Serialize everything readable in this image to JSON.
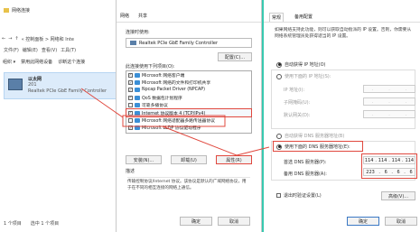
{
  "network_window": {
    "title": "网络连接",
    "address_path": "« 控制面板 > 网络和 Inte",
    "toolbar": [
      "文件(F)",
      "编辑(E)",
      "查看(V)",
      "工具(T)"
    ],
    "commands": [
      "组织 ▾",
      "禁用此网络设备",
      "诊断这个连接"
    ],
    "adapter_name": "以太网",
    "adapter_sub": "201",
    "adapter_desc": "Realtek PCIe GbE Family Controller",
    "status_count": "1 个项目",
    "status_sel": "选中 1 个项目"
  },
  "properties_window": {
    "tabs": [
      "网络",
      "共享"
    ],
    "connect_using_label": "连接时使用:",
    "adapter": "Realtek PCIe GbE Family Controller",
    "configure_button": "配置(C)...",
    "items_label": "此连接使用下列项目(O):",
    "items": [
      {
        "label": "Microsoft 网络客户端",
        "checked": true,
        "highlight": false
      },
      {
        "label": "Microsoft 网络的文件和打印机共享",
        "checked": true,
        "highlight": false
      },
      {
        "label": "Npcap Packet Driver (NPCAP)",
        "checked": true,
        "highlight": false
      },
      {
        "label": "QoS 数据包计划程序",
        "checked": true,
        "highlight": false
      },
      {
        "label": "可靠多播协议",
        "checked": false,
        "highlight": false
      },
      {
        "label": "Internet 协议版本 4 (TCP/IPv4)",
        "checked": true,
        "highlight": true
      },
      {
        "label": "Microsoft 网络适配器多路传送器协议",
        "checked": false,
        "highlight": false
      },
      {
        "label": "Microsoft LLDP 协议驱动程序",
        "checked": true,
        "highlight": false
      }
    ],
    "install_button": "安装(N)...",
    "uninstall_button": "卸载(U)",
    "props_button": "属性(R)",
    "description_label": "描述",
    "description": "传输控制协议/Internet 协议。该协议是默认的广域网络协议，用于在不同的相互连接的网络上通信。",
    "ok_button": "确定",
    "cancel_button": "取消"
  },
  "ipv4_window": {
    "tabs": [
      "常规",
      "备用配置"
    ],
    "description": "如果网络支持此功能，则可以获取自动指派的 IP 设置。否则，你需要从网络系统管理员处获得适当的 IP 设置。",
    "auto_ip": "自动获得 IP 地址(O)",
    "manual_ip": "使用下面的 IP 地址(S):",
    "ip_label": "IP 地址(I):",
    "mask_label": "子网掩码(U):",
    "gateway_label": "默认网关(D):",
    "auto_dns": "自动获得 DNS 服务器地址(B)",
    "manual_dns": "使用下面的 DNS 服务器地址(E):",
    "dns1_label": "首选 DNS 服务器(P):",
    "dns1": [
      "114",
      "114",
      "114",
      "114"
    ],
    "dns2_label": "备用 DNS 服务器(A):",
    "dns2": [
      "223",
      "6",
      "6",
      "6"
    ],
    "validate_label": "退出时验证设置(L)",
    "advanced_button": "高级(V)...",
    "ok_button": "确定",
    "cancel_button": "取消"
  }
}
